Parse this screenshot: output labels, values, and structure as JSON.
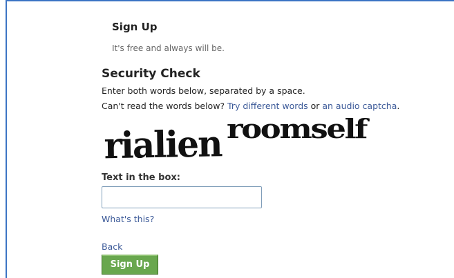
{
  "signup": {
    "heading": "Sign Up",
    "subheading": "It's free and always will be."
  },
  "security": {
    "title": "Security Check",
    "instruction_1": "Enter both words below, separated by a space.",
    "instruction_2_prefix": "Can't read the words below? ",
    "try_different_link": "Try different words",
    "or_text": " or ",
    "audio_link": "an audio captcha",
    "suffix": "."
  },
  "captcha": {
    "word_1": "rialien",
    "word_2": "roomself"
  },
  "form": {
    "text_label": "Text in the box:",
    "input_value": "",
    "whats_this": "What's this?",
    "back": "Back",
    "submit": "Sign Up"
  },
  "colors": {
    "frame_border": "#3b74c4",
    "link": "#3b5998",
    "button_bg": "#69a74e"
  }
}
